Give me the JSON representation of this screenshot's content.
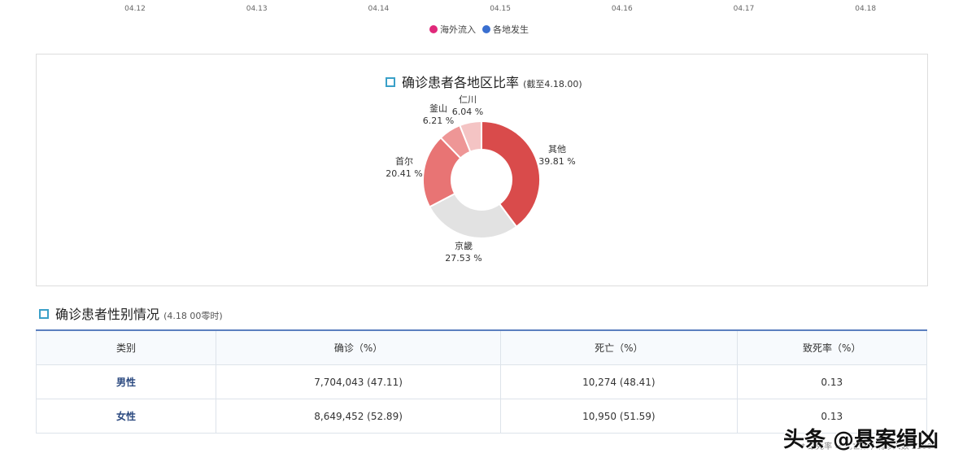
{
  "top_axis": {
    "ticks": [
      "04.12",
      "04.13",
      "04.14",
      "04.15",
      "04.16",
      "04.17",
      "04.18"
    ]
  },
  "top_legend": [
    {
      "label": "海外流入",
      "color": "#e0287a"
    },
    {
      "label": "各地发生",
      "color": "#3a6fd0"
    }
  ],
  "chart_data": {
    "type": "pie",
    "title": "确诊患者各地区比率",
    "subtitle": "(截至4.18.00)",
    "slices": [
      {
        "label": "其他",
        "value": 39.81,
        "text": "39.81 %",
        "color": "#d94b4b"
      },
      {
        "label": "京畿",
        "value": 27.53,
        "text": "27.53 %",
        "color": "#e2e2e2"
      },
      {
        "label": "首尔",
        "value": 20.41,
        "text": "20.41 %",
        "color": "#e87474"
      },
      {
        "label": "釜山",
        "value": 6.21,
        "text": "6.21 %",
        "color": "#ee9696"
      },
      {
        "label": "仁川",
        "value": 6.04,
        "text": "6.04 %",
        "color": "#f4c4c4"
      }
    ]
  },
  "gender": {
    "title": "确诊患者性别情况",
    "subtitle": "(4.18 00零时)",
    "headers": [
      "类别",
      "确诊（%）",
      "死亡（%）",
      "致死率（%）"
    ],
    "rows": [
      [
        "男性",
        "7,704,043 (47.11)",
        "10,274 (48.41)",
        "0.13"
      ],
      [
        "女性",
        "8,649,452 (52.89)",
        "10,950 (51.59)",
        "0.13"
      ]
    ],
    "footnote": "* 致死率 = 死亡数 / 确诊人数 x100"
  },
  "watermark": "头条 @悬案缉凶"
}
